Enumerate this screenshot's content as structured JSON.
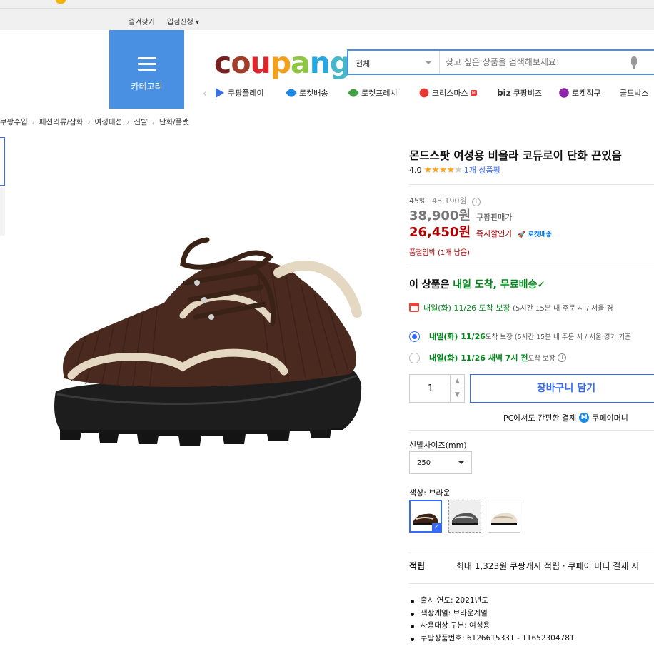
{
  "util_bar": {
    "bookmark": "즐겨찾기",
    "seller_apply": "입점신청 ▾"
  },
  "header": {
    "category_label": "카테고리",
    "logo": {
      "c": "c",
      "o": "o",
      "u": "u",
      "p": "p",
      "a": "a",
      "n": "n",
      "g": "g"
    },
    "search": {
      "category": "전체",
      "placeholder": "찾고 싶은 상품을 검색해보세요!"
    }
  },
  "quicknav": [
    {
      "label": "쿠팡플레이",
      "icon": "coupang-play-icon",
      "color": "#3b6fe0"
    },
    {
      "label": "로켓배송",
      "icon": "rocket-icon",
      "color": "#1e88e5"
    },
    {
      "label": "로켓프레시",
      "icon": "rocket-fresh-icon",
      "color": "#43a047"
    },
    {
      "label": "크리스마스",
      "icon": "santa-icon",
      "color": "#e53935"
    },
    {
      "label": "쿠팡비즈",
      "icon": "biz-icon",
      "color": "#333333"
    },
    {
      "label": "로켓직구",
      "icon": "rocket-global-icon",
      "color": "#8e24aa"
    },
    {
      "label": "골드박스",
      "icon": "",
      "color": "#999999"
    }
  ],
  "quicknav_badge": "N",
  "quicknav_biz": "biz",
  "breadcrumb": [
    "쿠팡수입",
    "패션의류/잡화",
    "여성패션",
    "신발",
    "단화/플랫"
  ],
  "product": {
    "title": "몬드스팟 여성용 비올라 코듀로이 단화 끈있음",
    "rating": "4.0",
    "stars": 4,
    "reviews": "1개 상품평",
    "discount_rate": "45%",
    "original_price": "48,190원",
    "sale_price": "38,900원",
    "sale_label": "쿠팡판매가",
    "instant_price": "26,450원",
    "instant_label": "즉시할인가",
    "rocket_label": "로켓배송",
    "stock_note": "품절임박 (1개 남음)"
  },
  "shipping": {
    "headline_prefix": "이 상품은 ",
    "headline_green": "내일 도착, 무료배송",
    "check": "✓",
    "line_green": "내일(화) 11/26 도착 보장",
    "line_tail": "(5시간 15분  내 주문 시 / 서울·경",
    "options": [
      {
        "green": "내일(화) 11/26",
        "rest": " 도착 보장 (5시간 15분 내 주문 시 / 서울·경기 기준",
        "selected": true
      },
      {
        "green": "내일(화) 11/26 새벽 7시 전",
        "rest": " 도착 보장",
        "selected": false
      }
    ],
    "info_glyph": "i"
  },
  "purchase": {
    "quantity": "1",
    "cart_label": "장바구니 담기",
    "pc_pay": "PC에서도 간편한 결제",
    "coupay_badge": "M",
    "coupay": "쿠페이머니"
  },
  "size": {
    "label": "신발사이즈(mm)",
    "value": "250"
  },
  "color": {
    "label": "색상: 브라운",
    "check": "✓"
  },
  "points": {
    "label": "적립",
    "prefix": "최대 1,323원 ",
    "link": "쿠팡캐시 적립",
    "suffix": " · 쿠페이 머니 결제 시"
  },
  "specs": [
    "출시 연도: 2021년도",
    "색상계열: 브라운계열",
    "사용대상 구분: 여성용",
    "쿠팡상품번호: 6126615331 - 11652304781"
  ],
  "colors": {
    "accent": "#346aff",
    "category_blue": "#4a90e2",
    "price_red": "#ae0000",
    "delivery_green": "#00891a"
  }
}
